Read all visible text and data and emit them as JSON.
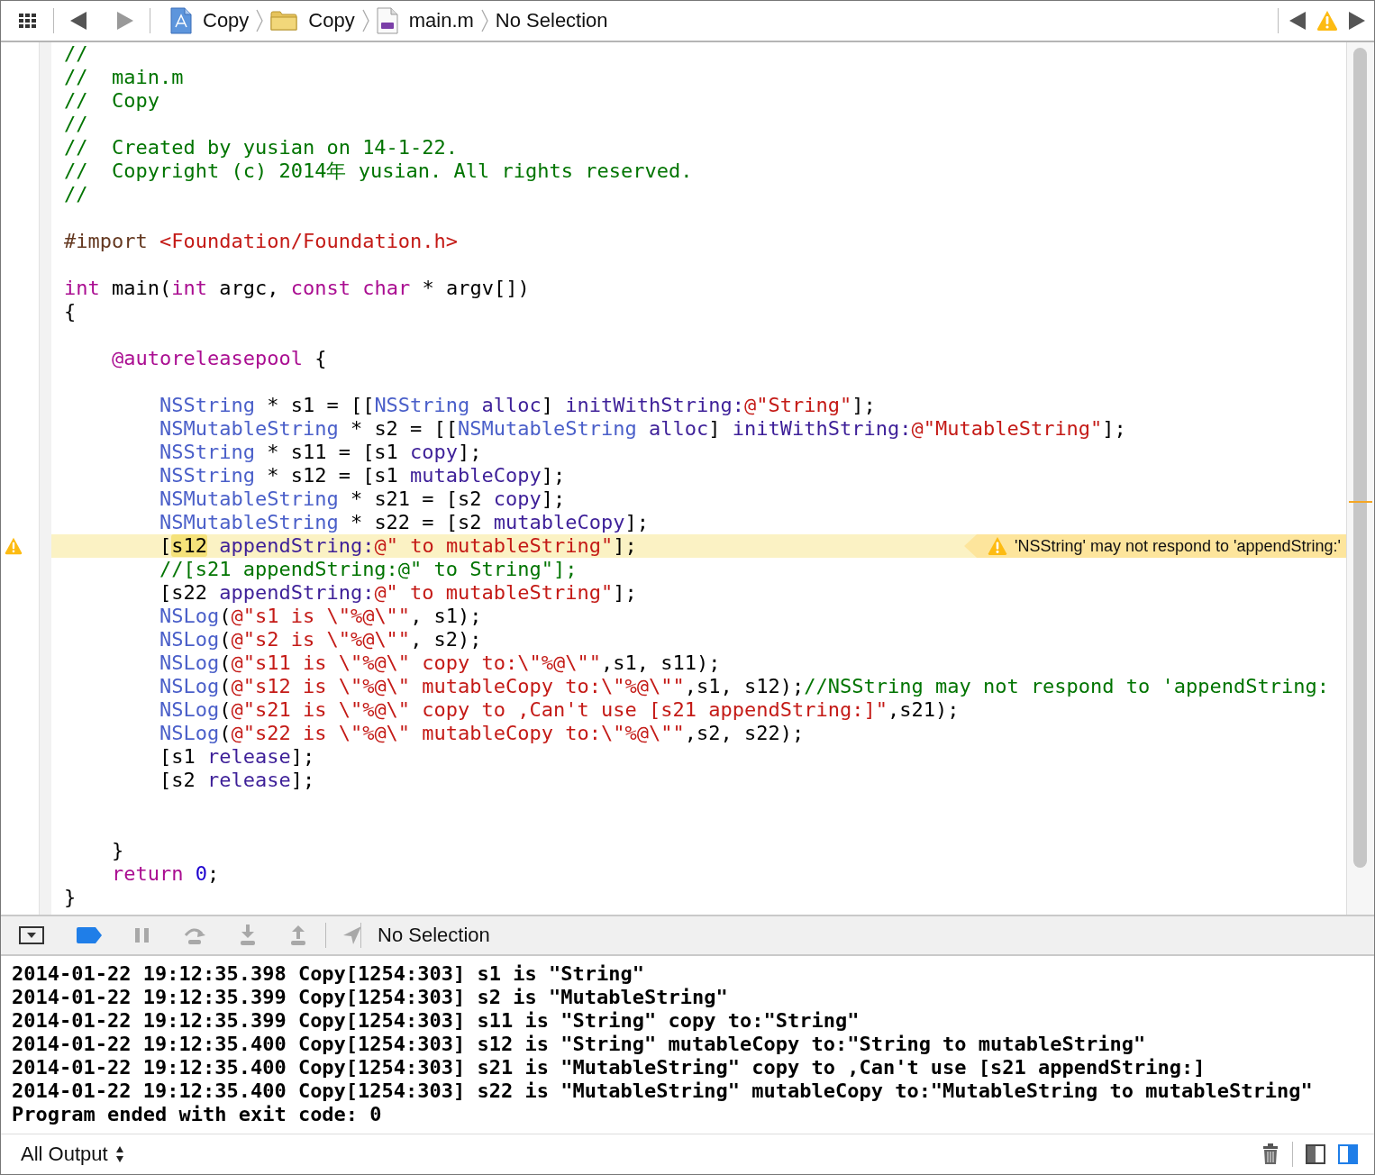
{
  "breadcrumb": [
    {
      "kind": "project",
      "label": "Copy"
    },
    {
      "kind": "folder",
      "label": "Copy"
    },
    {
      "kind": "file",
      "label": "main.m"
    },
    {
      "kind": "none",
      "label": "No Selection"
    }
  ],
  "editor": {
    "lines": [
      {
        "kind": "code",
        "tokens": [
          {
            "kind": "comment",
            "text": "//"
          }
        ]
      },
      {
        "kind": "code",
        "tokens": [
          {
            "kind": "comment",
            "text": "//  main.m"
          }
        ]
      },
      {
        "kind": "code",
        "tokens": [
          {
            "kind": "comment",
            "text": "//  Copy"
          }
        ]
      },
      {
        "kind": "code",
        "tokens": [
          {
            "kind": "comment",
            "text": "//"
          }
        ]
      },
      {
        "kind": "code",
        "tokens": [
          {
            "kind": "comment",
            "text": "//  Created by yusian on 14-1-22."
          }
        ]
      },
      {
        "kind": "code",
        "tokens": [
          {
            "kind": "comment",
            "text": "//  Copyright (c) 2014年 yusian. All rights reserved."
          }
        ]
      },
      {
        "kind": "code",
        "tokens": [
          {
            "kind": "comment",
            "text": "//"
          }
        ]
      },
      {
        "kind": "blank"
      },
      {
        "kind": "code",
        "tokens": [
          {
            "kind": "directive",
            "text": "#import "
          },
          {
            "kind": "string",
            "text": "<Foundation/Foundation.h>"
          }
        ]
      },
      {
        "kind": "blank"
      },
      {
        "kind": "code",
        "tokens": [
          {
            "kind": "keyword",
            "text": "int"
          },
          {
            "kind": "plain",
            "text": " main("
          },
          {
            "kind": "keyword",
            "text": "int"
          },
          {
            "kind": "plain",
            "text": " argc, "
          },
          {
            "kind": "keyword",
            "text": "const "
          },
          {
            "kind": "keyword",
            "text": "char"
          },
          {
            "kind": "plain",
            "text": " * argv[])"
          }
        ]
      },
      {
        "kind": "code",
        "tokens": [
          {
            "kind": "plain",
            "text": "{"
          }
        ]
      },
      {
        "kind": "blank"
      },
      {
        "kind": "code",
        "tokens": [
          {
            "kind": "keyword",
            "text": "    @autoreleasepool"
          },
          {
            "kind": "plain",
            "text": " {"
          }
        ]
      },
      {
        "kind": "blank"
      },
      {
        "kind": "code",
        "tokens": [
          {
            "kind": "class",
            "text": "        NSString"
          },
          {
            "kind": "plain",
            "text": " * s1 = [["
          },
          {
            "kind": "class",
            "text": "NSString "
          },
          {
            "kind": "method",
            "text": "alloc"
          },
          {
            "kind": "plain",
            "text": "] "
          },
          {
            "kind": "method",
            "text": "initWithString:"
          },
          {
            "kind": "string",
            "text": "@\"String\""
          },
          {
            "kind": "plain",
            "text": "];"
          }
        ]
      },
      {
        "kind": "code",
        "tokens": [
          {
            "kind": "class",
            "text": "        NSMutableString"
          },
          {
            "kind": "plain",
            "text": " * s2 = [["
          },
          {
            "kind": "class",
            "text": "NSMutableString "
          },
          {
            "kind": "method",
            "text": "alloc"
          },
          {
            "kind": "plain",
            "text": "] "
          },
          {
            "kind": "method",
            "text": "initWithString:"
          },
          {
            "kind": "string",
            "text": "@\"MutableString\""
          },
          {
            "kind": "plain",
            "text": "];"
          }
        ]
      },
      {
        "kind": "code",
        "tokens": [
          {
            "kind": "class",
            "text": "        NSString"
          },
          {
            "kind": "plain",
            "text": " * s11 = [s1 "
          },
          {
            "kind": "method",
            "text": "copy"
          },
          {
            "kind": "plain",
            "text": "];"
          }
        ]
      },
      {
        "kind": "code",
        "tokens": [
          {
            "kind": "class",
            "text": "        NSString"
          },
          {
            "kind": "plain",
            "text": " * s12 = [s1 "
          },
          {
            "kind": "method",
            "text": "mutableCopy"
          },
          {
            "kind": "plain",
            "text": "];"
          }
        ]
      },
      {
        "kind": "code",
        "tokens": [
          {
            "kind": "class",
            "text": "        NSMutableString"
          },
          {
            "kind": "plain",
            "text": " * s21 = [s2 "
          },
          {
            "kind": "method",
            "text": "copy"
          },
          {
            "kind": "plain",
            "text": "];"
          }
        ]
      },
      {
        "kind": "code",
        "tokens": [
          {
            "kind": "class",
            "text": "        NSMutableString"
          },
          {
            "kind": "plain",
            "text": " * s22 = [s2 "
          },
          {
            "kind": "method",
            "text": "mutableCopy"
          },
          {
            "kind": "plain",
            "text": "];"
          }
        ]
      },
      {
        "kind": "code",
        "issue": {
          "kind": "warning",
          "message": "'NSString' may not respond to 'appendString:'"
        },
        "tokens": [
          {
            "kind": "plain",
            "text": "        ["
          },
          {
            "kind": "symbol-highlight",
            "text": "s12"
          },
          {
            "kind": "method",
            "text": " appendString:"
          },
          {
            "kind": "string",
            "text": "@\" to mutableString\""
          },
          {
            "kind": "plain",
            "text": "];"
          }
        ]
      },
      {
        "kind": "code",
        "tokens": [
          {
            "kind": "comment",
            "text": "        //[s21 appendString:@\" to String\"];"
          }
        ]
      },
      {
        "kind": "code",
        "tokens": [
          {
            "kind": "plain",
            "text": "        [s22 "
          },
          {
            "kind": "method",
            "text": "appendString:"
          },
          {
            "kind": "string",
            "text": "@\" to mutableString\""
          },
          {
            "kind": "plain",
            "text": "];"
          }
        ]
      },
      {
        "kind": "code",
        "tokens": [
          {
            "kind": "class",
            "text": "        NSLog"
          },
          {
            "kind": "plain",
            "text": "("
          },
          {
            "kind": "string",
            "text": "@\"s1 is \\\"%@\\\"\""
          },
          {
            "kind": "plain",
            "text": ", s1);"
          }
        ]
      },
      {
        "kind": "code",
        "tokens": [
          {
            "kind": "class",
            "text": "        NSLog"
          },
          {
            "kind": "plain",
            "text": "("
          },
          {
            "kind": "string",
            "text": "@\"s2 is \\\"%@\\\"\""
          },
          {
            "kind": "plain",
            "text": ", s2);"
          }
        ]
      },
      {
        "kind": "code",
        "tokens": [
          {
            "kind": "class",
            "text": "        NSLog"
          },
          {
            "kind": "plain",
            "text": "("
          },
          {
            "kind": "string",
            "text": "@\"s11 is \\\"%@\\\" copy to:\\\"%@\\\"\""
          },
          {
            "kind": "plain",
            "text": ",s1, s11);"
          }
        ]
      },
      {
        "kind": "code",
        "tokens": [
          {
            "kind": "class",
            "text": "        NSLog"
          },
          {
            "kind": "plain",
            "text": "("
          },
          {
            "kind": "string",
            "text": "@\"s12 is \\\"%@\\\" mutableCopy to:\\\"%@\\\"\""
          },
          {
            "kind": "plain",
            "text": ",s1, s12);"
          },
          {
            "kind": "comment",
            "text": "//NSString may not respond to 'appendString:"
          }
        ]
      },
      {
        "kind": "code",
        "tokens": [
          {
            "kind": "class",
            "text": "        NSLog"
          },
          {
            "kind": "plain",
            "text": "("
          },
          {
            "kind": "string",
            "text": "@\"s21 is \\\"%@\\\" copy to ,Can't use [s21 appendString:]\""
          },
          {
            "kind": "plain",
            "text": ",s21);"
          }
        ]
      },
      {
        "kind": "code",
        "tokens": [
          {
            "kind": "class",
            "text": "        NSLog"
          },
          {
            "kind": "plain",
            "text": "("
          },
          {
            "kind": "string",
            "text": "@\"s22 is \\\"%@\\\" mutableCopy to:\\\"%@\\\"\""
          },
          {
            "kind": "plain",
            "text": ",s2, s22);"
          }
        ]
      },
      {
        "kind": "code",
        "tokens": [
          {
            "kind": "plain",
            "text": "        [s1 "
          },
          {
            "kind": "method",
            "text": "release"
          },
          {
            "kind": "plain",
            "text": "];"
          }
        ]
      },
      {
        "kind": "code",
        "tokens": [
          {
            "kind": "plain",
            "text": "        [s2 "
          },
          {
            "kind": "method",
            "text": "release"
          },
          {
            "kind": "plain",
            "text": "];"
          }
        ]
      },
      {
        "kind": "blank"
      },
      {
        "kind": "blank"
      },
      {
        "kind": "code",
        "tokens": [
          {
            "kind": "plain",
            "text": "    }"
          }
        ]
      },
      {
        "kind": "code",
        "tokens": [
          {
            "kind": "keyword",
            "text": "    return "
          },
          {
            "kind": "number",
            "text": "0"
          },
          {
            "kind": "plain",
            "text": ";"
          }
        ]
      },
      {
        "kind": "code",
        "tokens": [
          {
            "kind": "plain",
            "text": "}"
          }
        ]
      }
    ]
  },
  "debug_bar": {
    "breakpoints_active": true,
    "location": "No Selection"
  },
  "console": {
    "lines": [
      "2014-01-22 19:12:35.398 Copy[1254:303] s1 is \"String\"",
      "2014-01-22 19:12:35.399 Copy[1254:303] s2 is \"MutableString\"",
      "2014-01-22 19:12:35.399 Copy[1254:303] s11 is \"String\" copy to:\"String\"",
      "2014-01-22 19:12:35.400 Copy[1254:303] s12 is \"String\" mutableCopy to:\"String to mutableString\"",
      "2014-01-22 19:12:35.400 Copy[1254:303] s21 is \"MutableString\" copy to ,Can't use [s21 appendString:]",
      "2014-01-22 19:12:35.400 Copy[1254:303] s22 is \"MutableString\" mutableCopy to:\"MutableString to mutableString\"",
      "Program ended with exit code: 0"
    ]
  },
  "output_filter": "All Output",
  "view_toggles": [
    {
      "kind": "variables",
      "selected": false
    },
    {
      "kind": "console",
      "selected": true
    }
  ]
}
